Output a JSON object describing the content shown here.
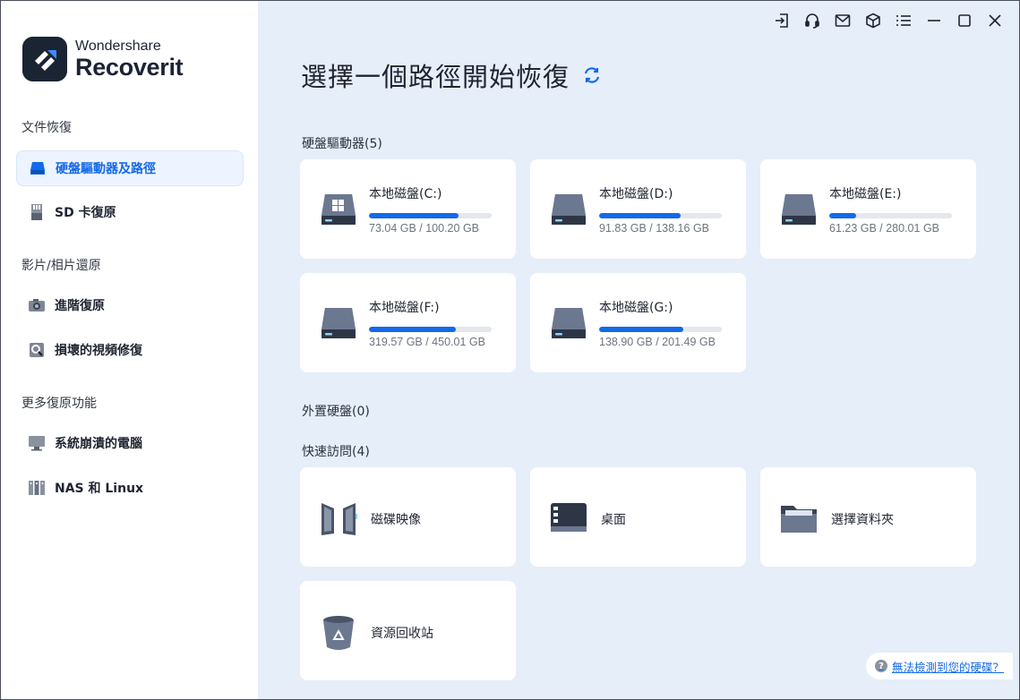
{
  "brand": {
    "company": "Wondershare",
    "product": "Recoverit"
  },
  "sidebar": {
    "sections": [
      {
        "label": "文件恢復",
        "items": [
          {
            "label": "硬盤驅動器及路徑",
            "icon": "hard-drive-icon",
            "active": true
          },
          {
            "label": "SD 卡復原",
            "icon": "sd-card-icon",
            "active": false
          }
        ]
      },
      {
        "label": "影片/相片還原",
        "items": [
          {
            "label": "進階復原",
            "icon": "camera-icon",
            "active": false
          },
          {
            "label": "損壞的視頻修復",
            "icon": "video-repair-icon",
            "active": false
          }
        ]
      },
      {
        "label": "更多復原功能",
        "items": [
          {
            "label": "系統崩潰的電腦",
            "icon": "monitor-icon",
            "active": false
          },
          {
            "label": "NAS 和 Linux",
            "icon": "nas-icon",
            "active": false
          }
        ]
      }
    ]
  },
  "main": {
    "title": "選擇一個路徑開始恢復",
    "hard_drives": {
      "label": "硬盤驅動器(5)",
      "drives": [
        {
          "name": "本地磁盤(C:)",
          "used": "73.04 GB",
          "total": "100.20 GB",
          "size_text": "73.04 GB / 100.20 GB",
          "fraction": 0.729,
          "icon": "windows-drive-icon"
        },
        {
          "name": "本地磁盤(D:)",
          "used": "91.83 GB",
          "total": "138.16 GB",
          "size_text": "91.83 GB / 138.16 GB",
          "fraction": 0.665,
          "icon": "hard-drive-icon"
        },
        {
          "name": "本地磁盤(E:)",
          "used": "61.23 GB",
          "total": "280.01 GB",
          "size_text": "61.23 GB / 280.01 GB",
          "fraction": 0.219,
          "icon": "hard-drive-icon"
        },
        {
          "name": "本地磁盤(F:)",
          "used": "319.57 GB",
          "total": "450.01 GB",
          "size_text": "319.57 GB / 450.01 GB",
          "fraction": 0.71,
          "icon": "hard-drive-icon"
        },
        {
          "name": "本地磁盤(G:)",
          "used": "138.90 GB",
          "total": "201.49 GB",
          "size_text": "138.90 GB / 201.49 GB",
          "fraction": 0.689,
          "icon": "hard-drive-icon"
        }
      ]
    },
    "external": {
      "label": "外置硬盤(0)"
    },
    "quick_access": {
      "label": "快速訪問(4)",
      "items": [
        {
          "label": "磁碟映像",
          "icon": "disk-image-icon"
        },
        {
          "label": "桌面",
          "icon": "desktop-icon"
        },
        {
          "label": "選擇資料夾",
          "icon": "folder-icon"
        },
        {
          "label": "資源回收站",
          "icon": "recycle-bin-icon"
        }
      ]
    },
    "help_link": "無法檢測到您的硬碟？"
  },
  "topbar": {
    "icons": [
      "sign-in-icon",
      "headset-icon",
      "mail-icon",
      "box-icon",
      "menu-icon",
      "minimize-icon",
      "maximize-icon",
      "close-icon"
    ]
  },
  "colors": {
    "accent": "#1469ea",
    "main_bg": "#e6eefa",
    "brand_dark": "#1b2433"
  }
}
